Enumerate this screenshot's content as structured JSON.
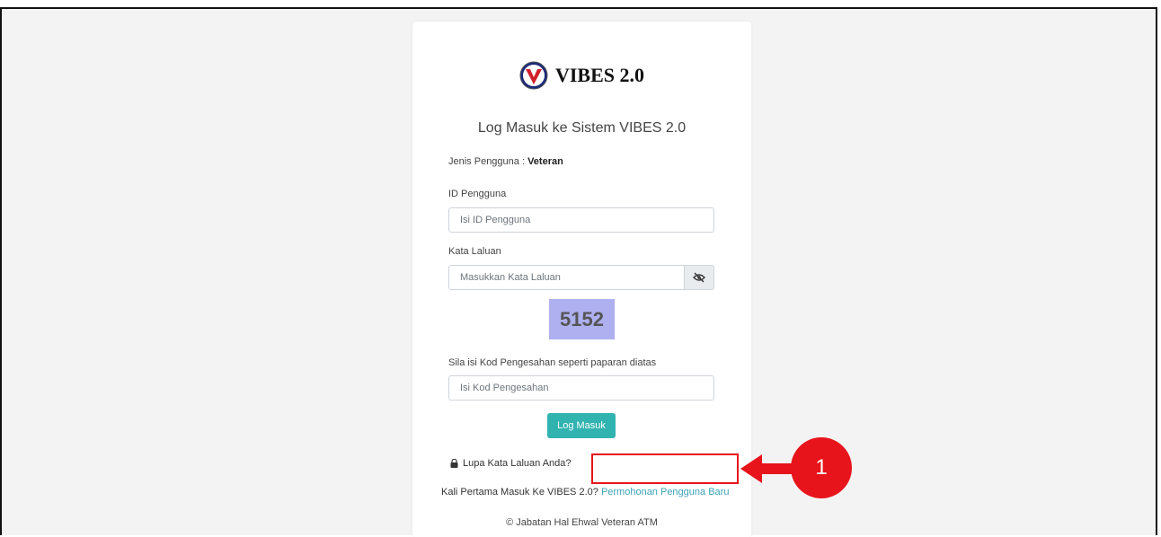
{
  "app": {
    "logo_text": "VIBES 2.0"
  },
  "login": {
    "title": "Log Masuk ke Sistem VIBES 2.0",
    "user_type_label": "Jenis Pengguna : ",
    "user_type_value": "Veteran",
    "user_id_label": "ID Pengguna",
    "user_id_placeholder": "Isi ID Pengguna",
    "password_label": "Kata Laluan",
    "password_placeholder": "Masukkan Kata Laluan",
    "password_toggle_icon": "eye-slash-icon",
    "captcha_code": "5152",
    "captcha_label": "Sila isi Kod Pengesahan seperti paparan diatas",
    "captcha_placeholder": "Isi Kod Pengesahan",
    "submit_label": "Log Masuk",
    "forgot_label": "Lupa Kata Laluan Anda?",
    "first_time_text": "Kali Pertama Masuk Ke VIBES 2.0?",
    "register_link": "Permohonan Pengguna Baru",
    "footer": "© Jabatan Hal Ehwal Veteran ATM"
  },
  "annotation": {
    "badge_number": "1",
    "highlight_color": "#e8141b"
  },
  "colors": {
    "primary_button": "#31b3b0",
    "link": "#3aa3b8",
    "captcha_bg": "#aeb0f0"
  }
}
